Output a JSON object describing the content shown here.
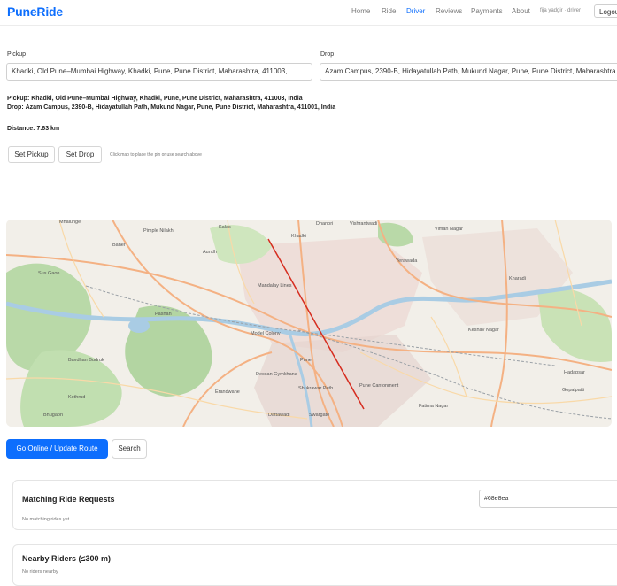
{
  "app": {
    "brand": "PuneRide"
  },
  "nav": {
    "items": [
      {
        "label": "Home"
      },
      {
        "label": "Ride"
      },
      {
        "label": "Driver"
      },
      {
        "label": "Reviews"
      },
      {
        "label": "Payments"
      },
      {
        "label": "About"
      }
    ],
    "active": "Driver",
    "user_label": "fija yadgir · driver",
    "logout_label": "Logou"
  },
  "form": {
    "pickup_label": "Pickup",
    "pickup_value": "Khadki, Old Pune–Mumbai Highway, Khadki, Pune, Pune District, Maharashtra, 411003,",
    "drop_label": "Drop",
    "drop_value": "Azam Campus, 2390-B, Hidayatullah Path, Mukund Nagar, Pune, Pune District, Maharashtra"
  },
  "summary": {
    "pickup_prefix": "Pickup:",
    "pickup_text": "Khadki, Old Pune–Mumbai Highway, Khadki, Pune, Pune District, Maharashtra, 411003, India",
    "drop_prefix": "Drop:",
    "drop_text": "Azam Campus, 2390-B, Hidayatullah Path, Mukund Nagar, Pune, Pune District, Maharashtra, 411001, India",
    "distance_prefix": "Distance:",
    "distance_value": "7.63 km"
  },
  "controls": {
    "set_pickup": "Set Pickup",
    "set_drop": "Set Drop",
    "hint": "Click map to place the pin or use search above"
  },
  "map": {
    "places": [
      "Mhalunge",
      "Pimple Nilakh",
      "Kalas",
      "Dhanori",
      "Vishrantwadi",
      "Viman Nagar",
      "Baner",
      "Aundh",
      "Khadki",
      "Yerawada",
      "Kharadi",
      "Sus Gaon",
      "Mandalay Lines",
      "Pashan",
      "Model Colony",
      "Keshav Nagar",
      "Bavdhan Budruk",
      "Pune",
      "Deccan Gymkhana",
      "Hadapsar",
      "Erandwane",
      "Pune Cantonment",
      "Gopalpatti",
      "Shukrawar Peth",
      "Kothrud",
      "Bhugaon",
      "Dattawadi",
      "Swargate",
      "Fatima Nagar"
    ],
    "route_color": "#d62d20"
  },
  "actions": {
    "go_online": "Go Online / Update Route",
    "search": "Search"
  },
  "requests": {
    "title": "Matching Ride Requests",
    "empty": "No matching rides yet",
    "filter_value": "#68e8ea"
  },
  "nearby": {
    "title": "Nearby Riders (≤300 m)",
    "empty": "No riders nearby"
  },
  "colors": {
    "accent": "#0d6efd",
    "route": "#d62d20"
  }
}
